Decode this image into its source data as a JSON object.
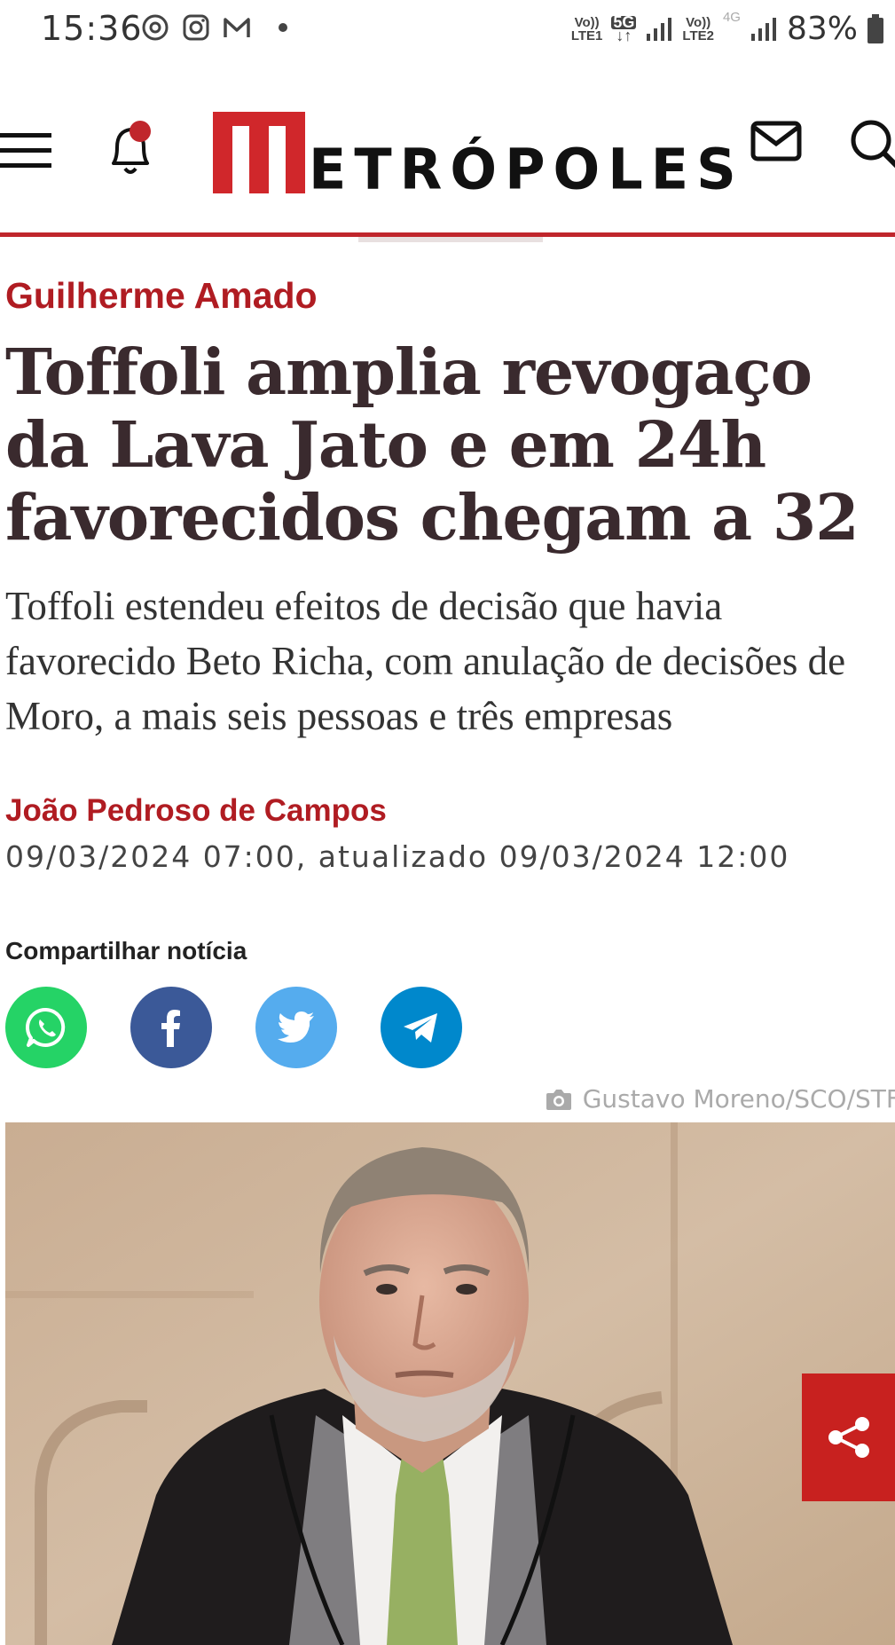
{
  "status_bar": {
    "time": "15:36",
    "net1_top": "Vo))",
    "net1_bottom": "LTE1",
    "net_5g": "5G",
    "net2_top": "Vo))",
    "net2_bottom": "LTE2",
    "net_4g": "4G",
    "battery": "83%",
    "icons": [
      "sync-icon",
      "instagram-icon",
      "gmail-icon",
      "notification-dot"
    ]
  },
  "header": {
    "logo_text": "ETRÓPOLES",
    "logo_letter": "M",
    "accent_color": "#c0262c",
    "icons": [
      "menu-icon",
      "bell-icon",
      "mail-icon",
      "search-icon"
    ]
  },
  "article": {
    "column": "Guilherme Amado",
    "headline": "Toffoli amplia revogaço da Lava Jato e em 24h favorecidos chegam a 32",
    "summary": "Toffoli estendeu efeitos de decisão que havia favorecido Beto Richa, com anulação de decisões de Moro, a mais seis pessoas e três empresas",
    "author": "João Pedroso de Campos",
    "dateline": "09/03/2024 07:00, atualizado 09/03/2024 12:00",
    "share_label": "Compartilhar notícia",
    "share_buttons": [
      {
        "name": "whatsapp",
        "color": "#25d366"
      },
      {
        "name": "facebook",
        "color": "#3b5998"
      },
      {
        "name": "twitter",
        "color": "#55acee"
      },
      {
        "name": "telegram",
        "color": "#0088cc"
      }
    ],
    "photo_credit": "Gustavo Moreno/SCO/STF"
  }
}
